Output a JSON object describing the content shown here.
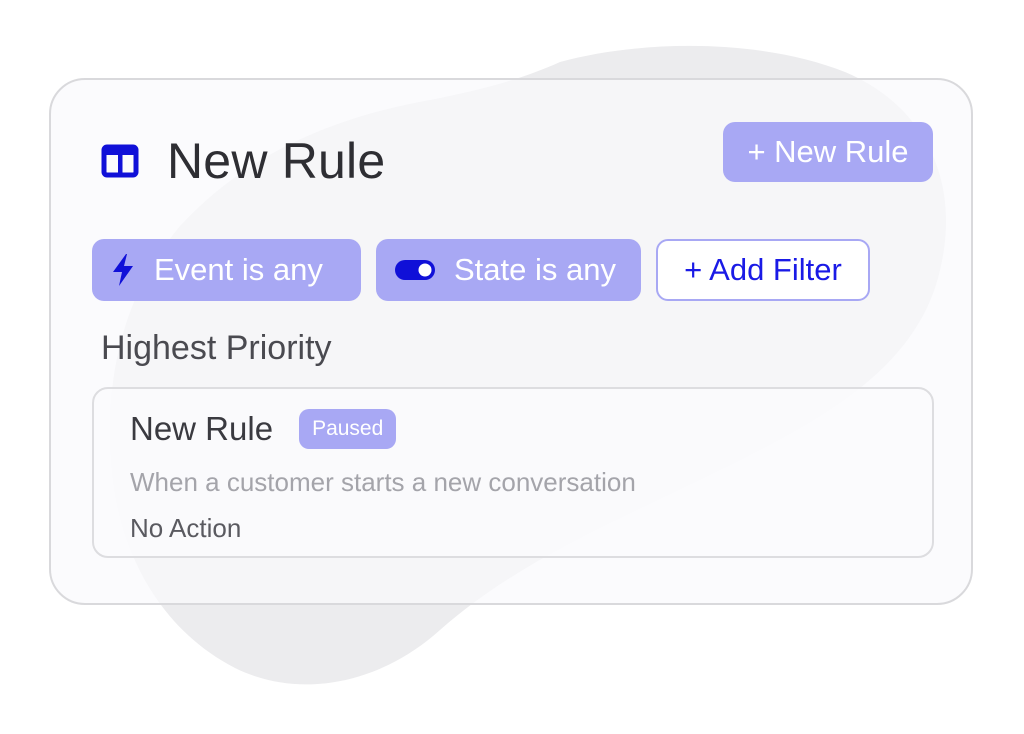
{
  "colors": {
    "accent": "#a8a8f4",
    "accent_text": "#1a1ae6",
    "icon_blue": "#1010d8",
    "title_text": "#2e2e33",
    "muted_text": "#a4a4aa",
    "card_border": "#d9d9dc",
    "blob": "#ececee"
  },
  "header": {
    "title": "New Rule",
    "title_icon": "columns-icon",
    "new_rule_button": "+ New Rule"
  },
  "filters": [
    {
      "label": "Event is any",
      "icon": "lightning-bolt-icon"
    },
    {
      "label": "State is any",
      "icon": "toggle-switch-icon"
    },
    {
      "label": "+ Add Filter"
    }
  ],
  "section": {
    "label": "Highest Priority"
  },
  "rules": [
    {
      "name": "New Rule",
      "status": "Paused",
      "description": "When a customer starts a new conversation",
      "action": "No Action"
    }
  ]
}
